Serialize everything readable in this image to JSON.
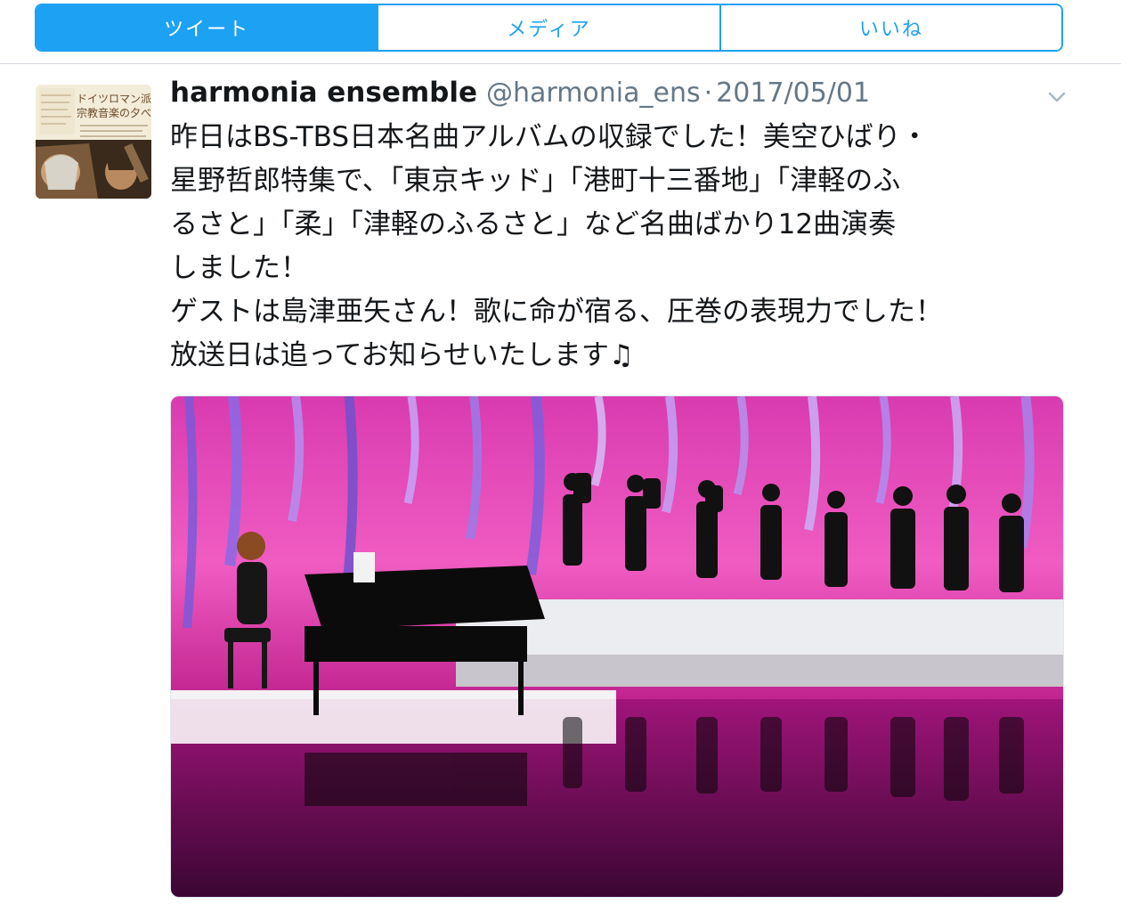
{
  "tabs": [
    {
      "label": "ツイート",
      "active": true
    },
    {
      "label": "メディア",
      "active": false
    },
    {
      "label": "いいね",
      "active": false
    }
  ],
  "tweet": {
    "author_name": "harmonia ensemble",
    "author_handle": "@harmonia_ens",
    "separator": "·",
    "date": "2017/05/01",
    "lines": [
      "昨日はBS-TBS日本名曲アルバムの収録でした！美空ひばり・",
      "星野哲郎特集で、「東京キッド」「港町十三番地」「津軽のふ",
      "るさと」「柔」「津軽のふるさと」など名曲ばかり12曲演奏",
      "しました！",
      "ゲストは島津亜矢さん！歌に命が宿る、圧巻の表現力でした！",
      "放送日は追ってお知らせいたします♫"
    ]
  },
  "avatar": {
    "title_line1": "ドイツロマン派",
    "title_line2": "宗教音楽の夕べ"
  },
  "colors": {
    "accent": "#1da1f2",
    "text": "#14171a",
    "secondary": "#657786",
    "stage_pink": "#e0309c"
  },
  "icons": {
    "caret": "chevron-down-icon",
    "music_note": "music-note"
  }
}
